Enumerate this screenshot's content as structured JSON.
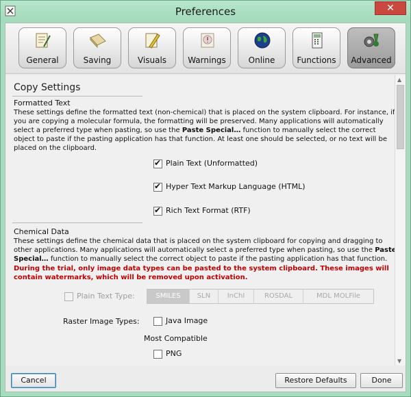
{
  "window": {
    "title": "Preferences",
    "close_glyph": "✕"
  },
  "toolbar": {
    "tabs": [
      {
        "label": "General",
        "icon": "general-icon",
        "active": false
      },
      {
        "label": "Saving",
        "icon": "saving-icon",
        "active": false
      },
      {
        "label": "Visuals",
        "icon": "visuals-icon",
        "active": false
      },
      {
        "label": "Warnings",
        "icon": "warnings-icon",
        "active": false
      },
      {
        "label": "Online",
        "icon": "online-globe-icon",
        "active": false
      },
      {
        "label": "Functions",
        "icon": "functions-icon",
        "active": false
      },
      {
        "label": "Advanced",
        "icon": "advanced-icon",
        "active": true
      }
    ]
  },
  "copy_settings": {
    "title": "Copy Settings",
    "formatted_text": {
      "title": "Formatted Text",
      "desc_1": "These settings define the formatted text (non-chemical) that is placed on the system clipboard. For instance, if you are copying a molecular formula, the formatting will be preserved. Many applications will automatically select a preferred type when pasting, so use the ",
      "desc_bold": "Paste Special…",
      "desc_2": " function to manually select the correct object to paste if the pasting application has that function. At least one should be selected, or no text will be placed on the clipboard.",
      "options": [
        {
          "label": "Plain Text (Unformatted)",
          "checked": true
        },
        {
          "label": "Hyper Text Markup Language (HTML)",
          "checked": true
        },
        {
          "label": "Rich Text Format (RTF)",
          "checked": true
        }
      ]
    },
    "chemical_data": {
      "title": "Chemical Data",
      "desc_1": "These settings define the chemical data that is placed on the system clipboard for copying and dragging to other applications. Many applications will automatically select a preferred type when pasting, so use the ",
      "desc_bold": "Paste Special…",
      "desc_2": " function to manually select the correct object to paste if the pasting application has that function.",
      "warning": "During the trial, only image data types can be pasted to the system clipboard. These images will contain watermarks, which will be removed upon activation.",
      "plain_text_type": {
        "label": "Plain Text Type:",
        "checked": false,
        "options": [
          "SMILES",
          "SLN",
          "InChI",
          "ROSDAL",
          "MDL MOLFile"
        ],
        "selected": "SMILES"
      },
      "raster": {
        "label": "Raster Image Types:",
        "java_image": {
          "label": "Java Image",
          "checked": false
        },
        "group_label": "Most Compatible",
        "png": {
          "label": "PNG",
          "checked": false
        }
      }
    }
  },
  "buttons": {
    "cancel": "Cancel",
    "restore_defaults": "Restore Defaults",
    "done": "Done"
  }
}
